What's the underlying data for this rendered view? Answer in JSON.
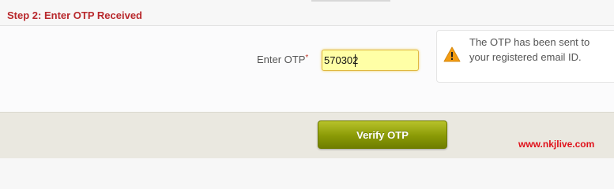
{
  "step": {
    "title": "Step 2: Enter OTP Received"
  },
  "form": {
    "otp_label": "Enter OTP",
    "required_marker": "*",
    "otp_value": "570302"
  },
  "notice": {
    "icon": "warning-icon",
    "message": "The OTP has been sent to your registered email ID."
  },
  "actions": {
    "verify_label": "Verify OTP"
  },
  "watermark": {
    "text": "www.nkjlive.com"
  },
  "colors": {
    "step_title": "#b8282c",
    "input_background": "#ffffa6",
    "button_green": "#8a9a06",
    "watermark_red": "#e0101a"
  }
}
